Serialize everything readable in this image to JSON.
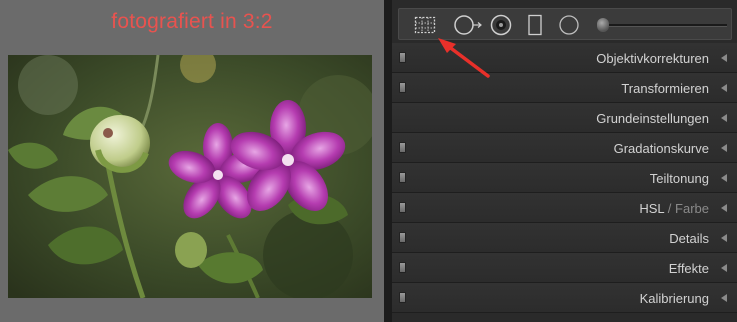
{
  "preview": {
    "caption": "fotografiert in 3:2"
  },
  "toolstrip": {
    "tools": [
      {
        "name": "crop-overlay-icon"
      },
      {
        "name": "spot-removal-icon"
      },
      {
        "name": "red-eye-icon"
      },
      {
        "name": "graduated-filter-icon"
      },
      {
        "name": "radial-filter-icon"
      },
      {
        "name": "adjustment-brush-icon"
      }
    ]
  },
  "sections": [
    {
      "label": "Objektivkorrekturen",
      "has_toggle": true
    },
    {
      "label": "Transformieren",
      "has_toggle": true
    },
    {
      "label": "Grundeinstellungen",
      "has_toggle": false
    },
    {
      "label": "Gradationskurve",
      "has_toggle": true
    },
    {
      "label": "Teiltonung",
      "has_toggle": true
    },
    {
      "label_main": "HSL",
      "label_sep": " / ",
      "label_dim": "Farbe",
      "has_toggle": true
    },
    {
      "label": "Details",
      "has_toggle": true
    },
    {
      "label": "Effekte",
      "has_toggle": true
    },
    {
      "label": "Kalibrierung",
      "has_toggle": true
    }
  ],
  "colors": {
    "caption": "#e8534f",
    "annotation_arrow": "#e8302a",
    "panel_bg": "#2a2a2a",
    "label": "#d2d2d2"
  }
}
